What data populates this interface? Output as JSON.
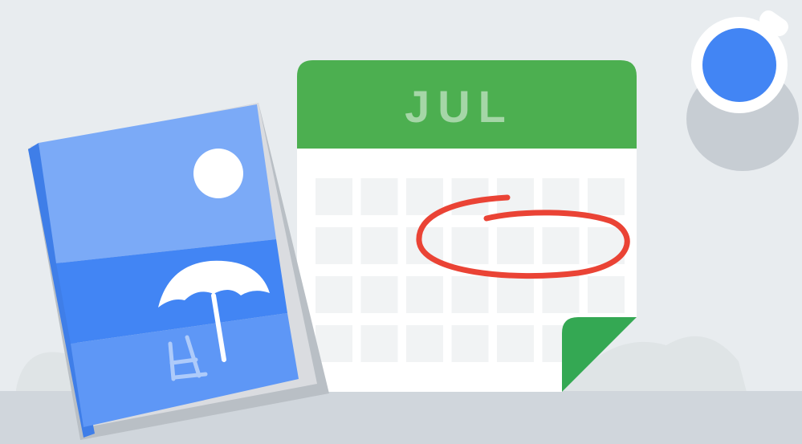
{
  "calendar": {
    "month_label": "JUL",
    "header_color": "#4caf50",
    "page_color": "#ffffff",
    "cell_color": "#f1f3f4",
    "fold_color": "#34a853",
    "circle_color": "#ea4335",
    "rows": 4,
    "cols": 7
  },
  "book": {
    "sky_color": "#7baaf7",
    "sea_color": "#4285f4",
    "sand_color": "#5e97f6",
    "spine_color": "#3f7ee8",
    "pages_color": "#dadce0",
    "sun_color": "#ffffff",
    "umbrella_color": "#ffffff",
    "chair_color": "#aecbfa"
  },
  "mug": {
    "color": "#ffffff",
    "coffee_color": "#4285f4",
    "shadow_color": "#c7cdd3"
  },
  "table": {
    "color": "#d0d6dc"
  },
  "icons": [
    "calendar-illustration",
    "travel-book-illustration",
    "coffee-mug-illustration",
    "beach-umbrella-icon",
    "beach-chair-icon",
    "sun-icon"
  ]
}
